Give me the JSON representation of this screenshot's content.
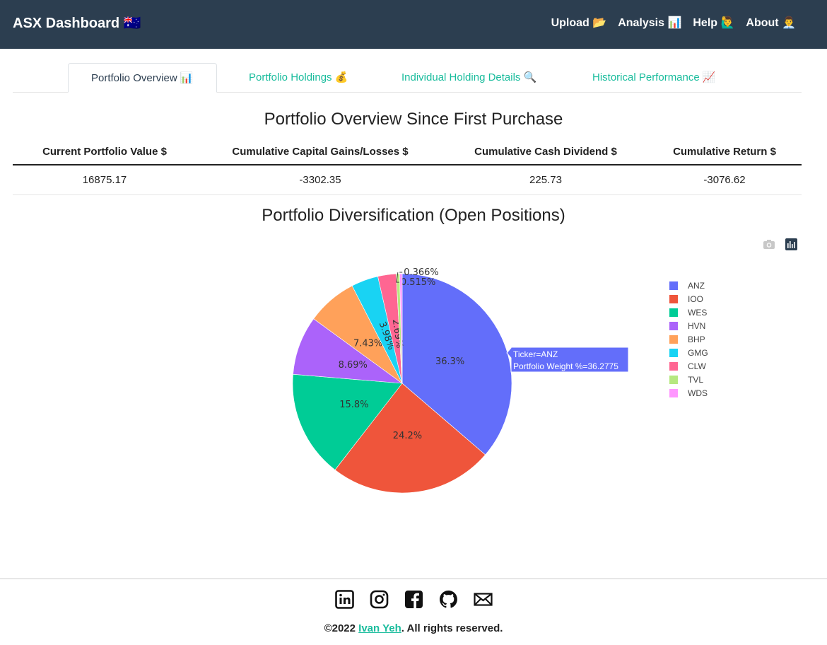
{
  "navbar": {
    "brand": "ASX Dashboard 🇦🇺",
    "links": [
      "Upload 📂",
      "Analysis 📊",
      "Help 🙋‍♂️",
      "About 👨‍💼"
    ]
  },
  "tabs": [
    {
      "label": "Portfolio Overview 📊",
      "active": true
    },
    {
      "label": "Portfolio Holdings 💰",
      "active": false
    },
    {
      "label": "Individual Holding Details 🔍",
      "active": false
    },
    {
      "label": "Historical Performance 📈",
      "active": false
    }
  ],
  "overview": {
    "title": "Portfolio Overview Since First Purchase",
    "headers": [
      "Current Portfolio Value $",
      "Cumulative Capital Gains/Losses $",
      "Cumulative Cash Dividend $",
      "Cumulative Return $"
    ],
    "values": [
      "16875.17",
      "-3302.35",
      "225.73",
      "-3076.62"
    ]
  },
  "diversification": {
    "title": "Portfolio Diversification (Open Positions)",
    "modebar": [
      "camera-icon",
      "plotly-logo-icon"
    ],
    "tooltip": {
      "line1": "Ticker=ANZ",
      "line2": "Portfolio Weight %=36.2775"
    }
  },
  "chart_data": {
    "type": "pie",
    "title": "Portfolio Diversification (Open Positions)",
    "categories": [
      "ANZ",
      "IOO",
      "WES",
      "HVN",
      "BHP",
      "GMG",
      "CLW",
      "TVL",
      "WDS"
    ],
    "values": [
      36.2775,
      24.2,
      15.8,
      8.69,
      7.43,
      3.98,
      2.69,
      0.515,
      0.366
    ],
    "labels": [
      "36.3%",
      "24.2%",
      "15.8%",
      "8.69%",
      "7.43%",
      "3.98%",
      "2.69%",
      "0.515%",
      "0.366%"
    ],
    "colors": [
      "#636efa",
      "#ef553b",
      "#00cc96",
      "#ab63fa",
      "#ffa15a",
      "#19d3f3",
      "#ff6692",
      "#b6e880",
      "#ff97ff"
    ],
    "legend_position": "right"
  },
  "footer": {
    "social_icons": [
      "linkedin-icon",
      "instagram-icon",
      "facebook-icon",
      "github-icon",
      "email-icon"
    ],
    "copyright_prefix": "©2022 ",
    "author": "Ivan Yeh",
    "copyright_suffix": ". All rights reserved."
  }
}
